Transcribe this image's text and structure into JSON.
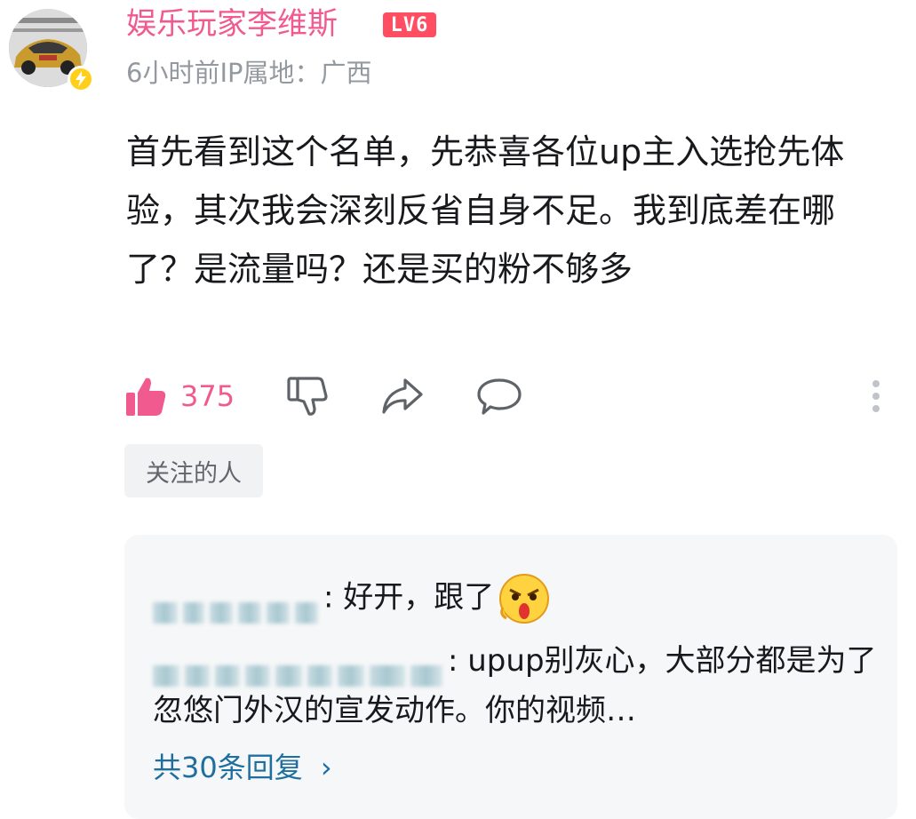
{
  "comment": {
    "username": "娱乐玩家李维斯",
    "level_badge": "LV6",
    "meta": "6小时前IP属地：广西",
    "text": "首先看到这个名单，先恭喜各位up主入选抢先体验，其次我会深刻反省自身不足。我到底差在哪了？是流量吗？还是买的粉不够多",
    "like_count": "375",
    "tag_label": "关注的人"
  },
  "replies": {
    "items": [
      {
        "text": ": 好开，跟了"
      },
      {
        "text": ": upup别灰心，大部分都是为了忽悠门外汉的宣发动作。你的视频…"
      }
    ],
    "more_label": "共30条回复",
    "more_chevron": "›"
  },
  "colors": {
    "username": "#f15a8f",
    "level_badge": "#ff4d61",
    "like": "#f15a8f",
    "link": "#1e6fa0",
    "reply_bg": "#f6f7f8"
  },
  "icons": [
    "like-icon",
    "dislike-icon",
    "share-icon",
    "comment-icon",
    "more-vertical-icon",
    "lightning-icon",
    "surprised-emoji-icon"
  ]
}
